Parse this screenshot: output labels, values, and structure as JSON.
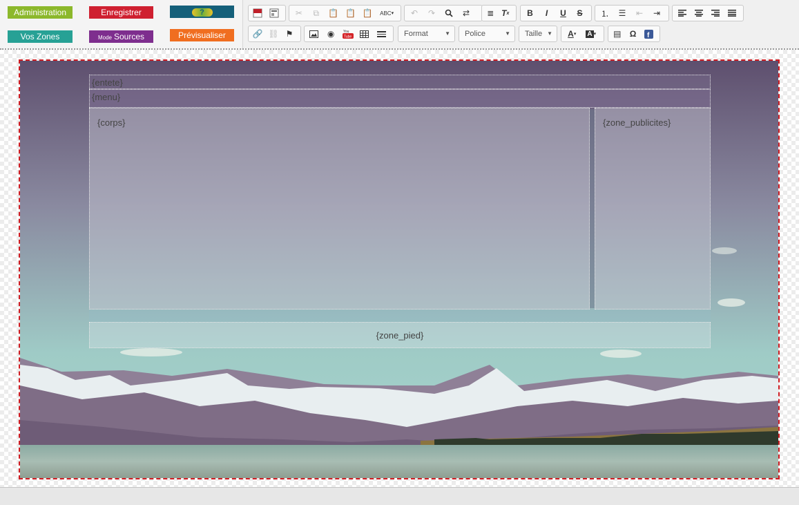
{
  "actions": {
    "administration": "Administration",
    "save": "Enregistrer",
    "help": "?",
    "zones": "Vos Zones",
    "sources_mode": "Mode",
    "sources": "Sources",
    "preview": "Prévisualiser"
  },
  "toolbar": {
    "format": "Format",
    "font": "Police",
    "size": "Taille"
  },
  "zones": {
    "header": "{entete}",
    "menu": "{menu}",
    "body": "{corps}",
    "ads": "{zone_publicites}",
    "footer": "{zone_pied}"
  },
  "colors": {
    "administration": "#8cb82b",
    "save": "#cf2030",
    "help": "#15607a",
    "zones": "#27a195",
    "sources": "#7e2e8e",
    "preview": "#f06e20",
    "canvas_border": "#d01c22"
  }
}
